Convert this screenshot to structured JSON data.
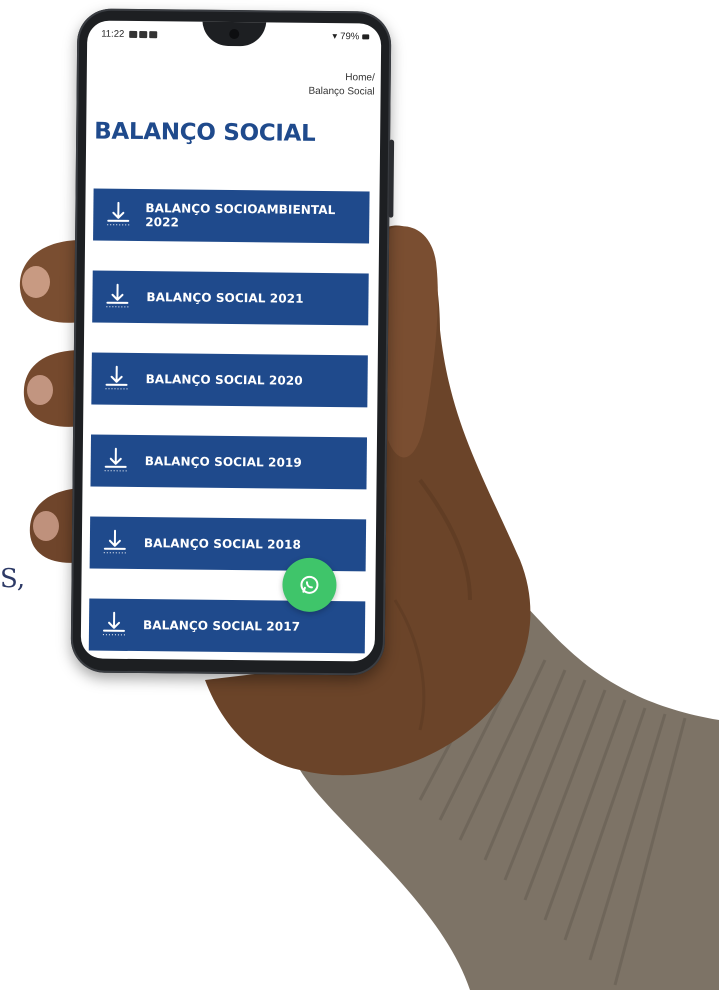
{
  "background": {
    "edge_text": "S,"
  },
  "status_bar": {
    "time": "11:22",
    "indicators": "▪ ▪ •",
    "right_text": "◂ฆ ฆ • 79%"
  },
  "breadcrumb": {
    "home": "Home/",
    "current": "Balanço Social"
  },
  "page": {
    "title": "BALANÇO SOCIAL"
  },
  "downloads": [
    {
      "label": "BALANÇO SOCIOAMBIENTAL 2022",
      "icon": "download-icon"
    },
    {
      "label": "BALANÇO SOCIAL 2021",
      "icon": "download-icon"
    },
    {
      "label": "BALANÇO SOCIAL 2020",
      "icon": "download-icon"
    },
    {
      "label": "BALANÇO SOCIAL 2019",
      "icon": "download-icon"
    },
    {
      "label": "BALANÇO SOCIAL 2018",
      "icon": "download-icon"
    },
    {
      "label": "BALANÇO SOCIAL 2017",
      "icon": "download-icon"
    }
  ],
  "colors": {
    "accent": "#1f4a8c",
    "whatsapp": "#3fc56a",
    "background_text": "#2d3a66"
  },
  "floating_action": {
    "icon": "whatsapp-icon"
  }
}
